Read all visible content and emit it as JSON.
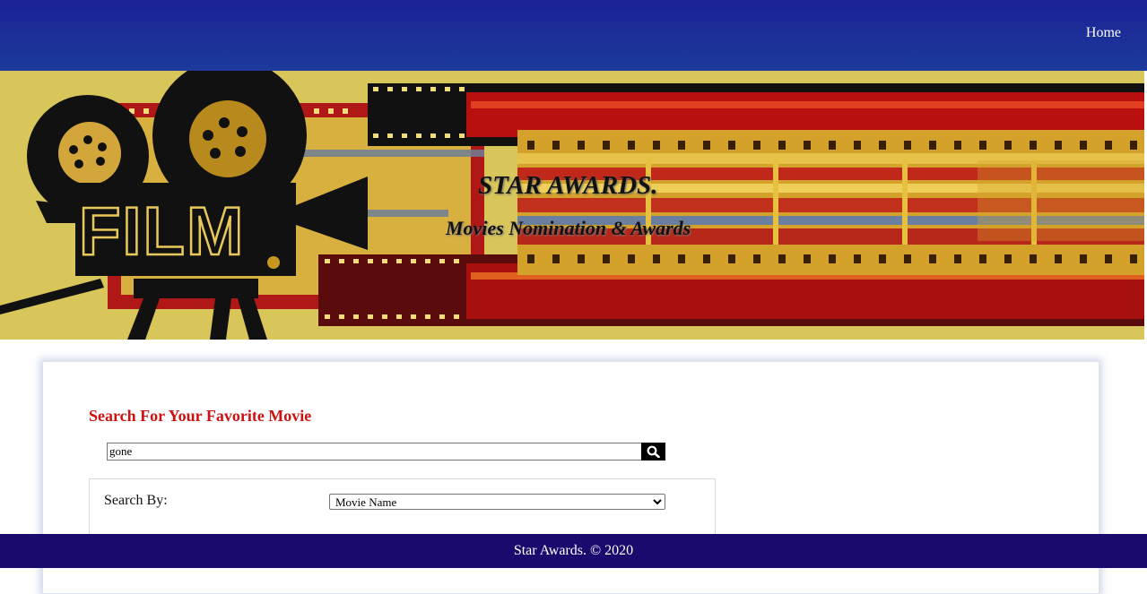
{
  "nav": {
    "home_label": "Home"
  },
  "banner": {
    "title": "STAR AWARDS.",
    "subtitle": "Movies Nomination & Awards",
    "logo_text": "FILM"
  },
  "search": {
    "heading": "Search For Your Favorite Movie",
    "query": "gone",
    "button_icon": "search-icon",
    "search_by_label": "Search By:",
    "search_by_selected": "Movie Name"
  },
  "footer": {
    "text": "Star Awards. © 2020"
  },
  "colors": {
    "nav_bg": "#1a2294",
    "banner_bg": "#d9c65a",
    "heading_red": "#cc1111",
    "footer_bg": "#1a0a6e"
  }
}
